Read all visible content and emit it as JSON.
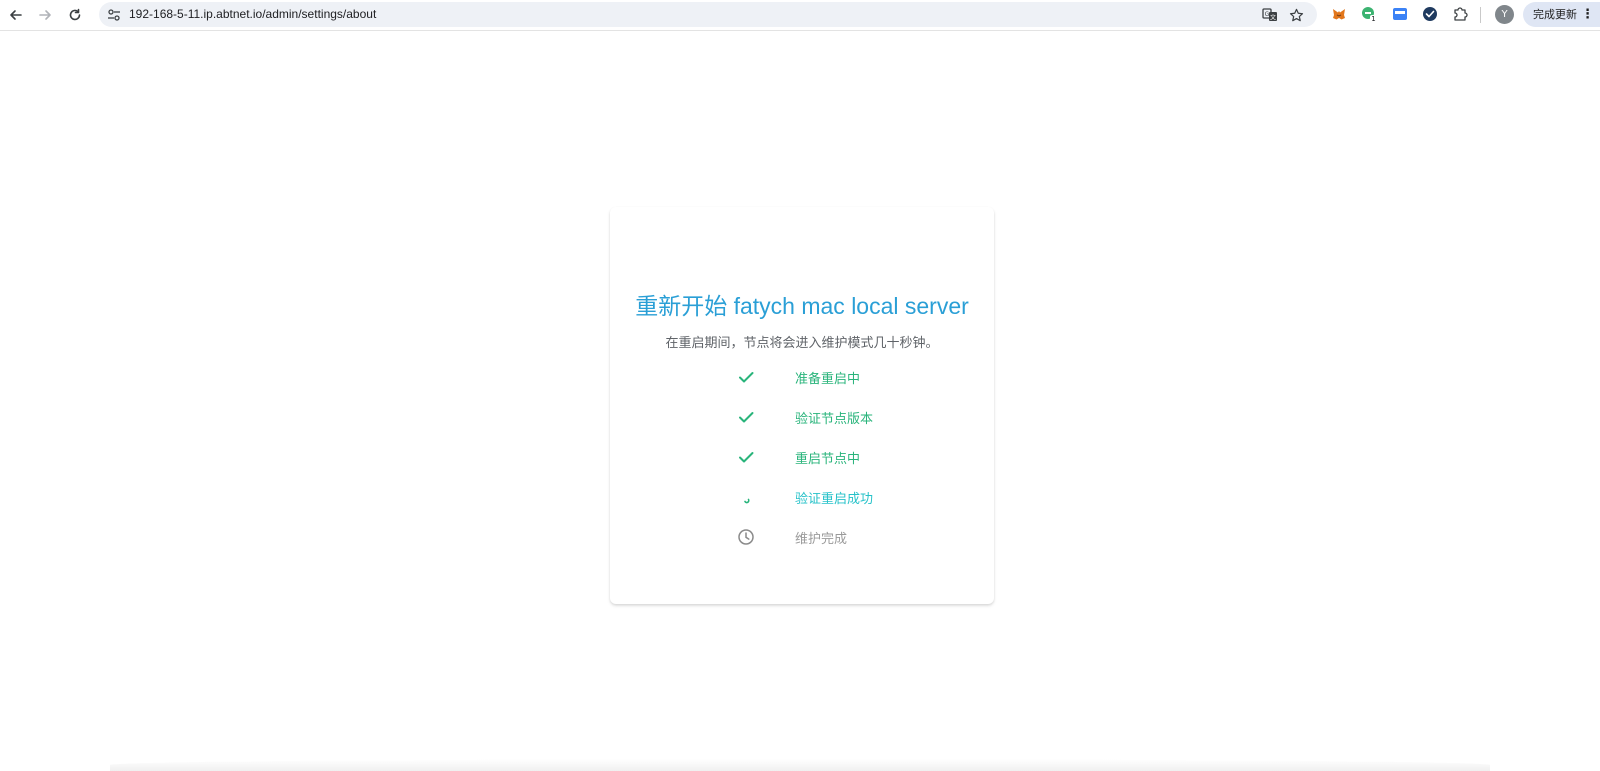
{
  "browser": {
    "url": "192-168-5-11.ip.abtnet.io/admin/settings/about",
    "update_button": "完成更新",
    "profile_initial": "Y",
    "extension_badge": "1"
  },
  "dialog": {
    "title": "重新开始 fatych mac local server",
    "description": "在重启期间，节点将会进入维护模式几十秒钟。",
    "steps": [
      {
        "label": "准备重启中",
        "status": "done"
      },
      {
        "label": "验证节点版本",
        "status": "done"
      },
      {
        "label": "重启节点中",
        "status": "done"
      },
      {
        "label": "验证重启成功",
        "status": "in-progress"
      },
      {
        "label": "维护完成",
        "status": "pending"
      }
    ]
  },
  "colors": {
    "done": "#29b47b",
    "in_progress": "#26c2c9",
    "pending": "#9a9a9a",
    "title": "#2a9fd6"
  }
}
